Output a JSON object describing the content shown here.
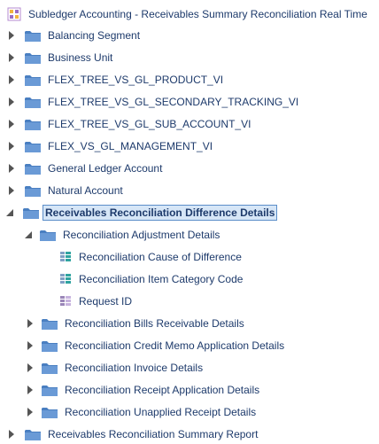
{
  "tree": {
    "root": {
      "label": "Subledger Accounting - Receivables Summary Reconciliation Real Time",
      "icon": "subject-area-icon"
    },
    "nodes": [
      {
        "label": "Balancing Segment",
        "type": "folder",
        "state": "collapsed"
      },
      {
        "label": "Business Unit",
        "type": "folder",
        "state": "collapsed"
      },
      {
        "label": "FLEX_TREE_VS_GL_PRODUCT_VI",
        "type": "folder",
        "state": "collapsed"
      },
      {
        "label": "FLEX_TREE_VS_GL_SECONDARY_TRACKING_VI",
        "type": "folder",
        "state": "collapsed"
      },
      {
        "label": "FLEX_TREE_VS_GL_SUB_ACCOUNT_VI",
        "type": "folder",
        "state": "collapsed"
      },
      {
        "label": "FLEX_VS_GL_MANAGEMENT_VI",
        "type": "folder",
        "state": "collapsed"
      },
      {
        "label": "General Ledger Account",
        "type": "folder",
        "state": "collapsed"
      },
      {
        "label": "Natural Account",
        "type": "folder",
        "state": "collapsed"
      },
      {
        "label": "Receivables Reconciliation Difference Details",
        "type": "folder",
        "state": "expanded",
        "selected": true
      },
      {
        "label": "Reconciliation Adjustment Details",
        "type": "folder",
        "state": "expanded"
      },
      {
        "label": "Reconciliation Cause of Difference",
        "type": "column"
      },
      {
        "label": "Reconciliation Item Category Code",
        "type": "column"
      },
      {
        "label": "Request ID",
        "type": "column"
      },
      {
        "label": "Reconciliation Bills Receivable Details",
        "type": "folder",
        "state": "collapsed"
      },
      {
        "label": "Reconciliation Credit Memo Application Details",
        "type": "folder",
        "state": "collapsed"
      },
      {
        "label": "Reconciliation Invoice Details",
        "type": "folder",
        "state": "collapsed"
      },
      {
        "label": "Reconciliation Receipt Application Details",
        "type": "folder",
        "state": "collapsed"
      },
      {
        "label": "Reconciliation Unapplied Receipt Details",
        "type": "folder",
        "state": "collapsed"
      },
      {
        "label": "Receivables Reconciliation Summary Report",
        "type": "folder",
        "state": "collapsed"
      }
    ]
  },
  "colors": {
    "text": "#1d3a6b",
    "folder": "#4a7fc1",
    "selection_bg": "#d6e6f7",
    "selection_border": "#5b8ec9",
    "toggle": "#555555"
  }
}
